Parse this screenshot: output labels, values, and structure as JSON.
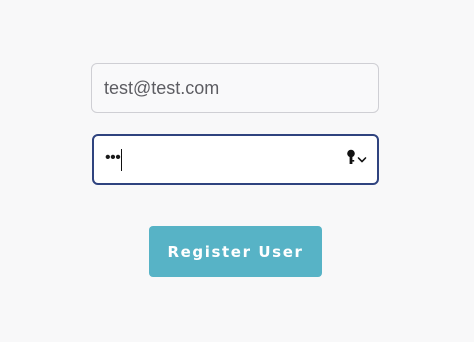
{
  "form": {
    "email_value": "test@test.com",
    "password_masked": "•••",
    "register_label": "Register User"
  },
  "icons": {
    "password_manager": "key-icon",
    "password_manager_menu": "chevron-down-icon"
  },
  "colors": {
    "button_background": "#57b3c6",
    "focused_border": "#2f437f",
    "page_background": "#f8f8f9"
  }
}
